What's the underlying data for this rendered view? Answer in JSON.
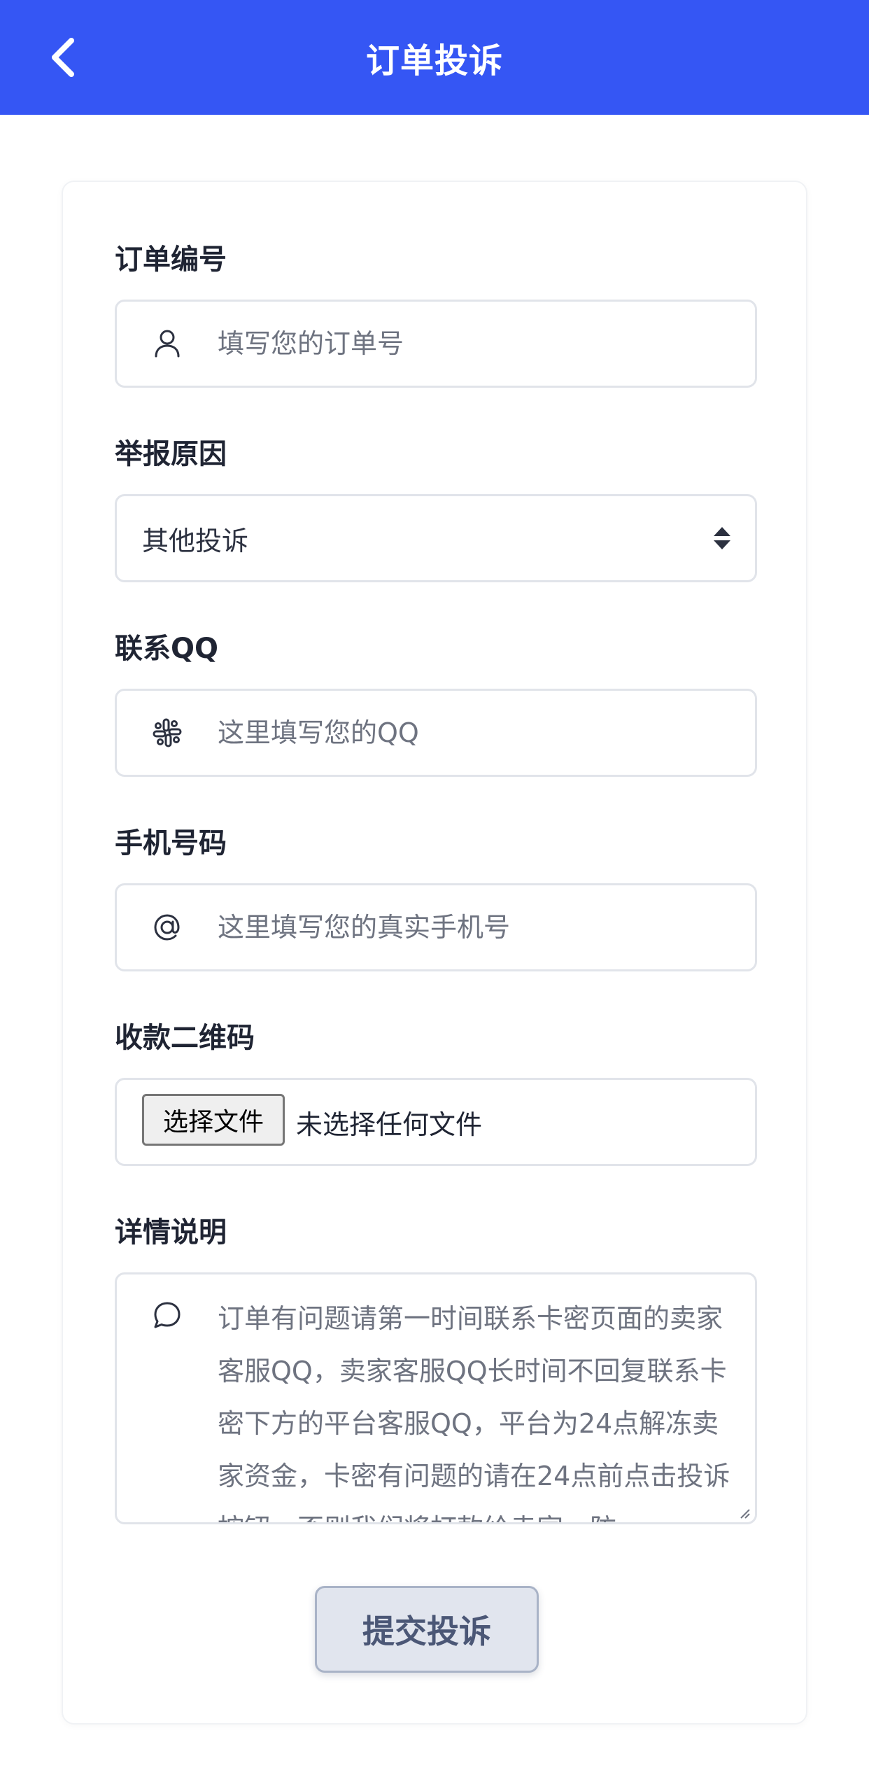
{
  "header": {
    "title": "订单投诉",
    "back_icon": "chevron-left-icon",
    "background_color": "#3556f4"
  },
  "form": {
    "order_number": {
      "label": "订单编号",
      "placeholder": "填写您的订单号",
      "icon": "user-icon"
    },
    "report_reason": {
      "label": "举报原因",
      "selected": "其他投诉",
      "icon": "sort-arrows-icon"
    },
    "contact_qq": {
      "label": "联系QQ",
      "placeholder": "这里填写您的QQ",
      "icon": "slack-icon"
    },
    "phone": {
      "label": "手机号码",
      "placeholder": "这里填写您的真实手机号",
      "icon": "at-sign-icon"
    },
    "qr_code": {
      "label": "收款二维码",
      "button_label": "选择文件",
      "status": "未选择任何文件"
    },
    "details": {
      "label": "详情说明",
      "placeholder": "订单有问题请第一时间联系卡密页面的卖家客服QQ，卖家客服QQ长时间不回复联系卡密下方的平台客服QQ，平台为24点解冻卖家资金，卡密有问题的请在24点前点击投诉按钮，否则我们将打款给卖家，防",
      "icon": "message-circle-icon"
    },
    "submit_label": "提交投诉"
  }
}
